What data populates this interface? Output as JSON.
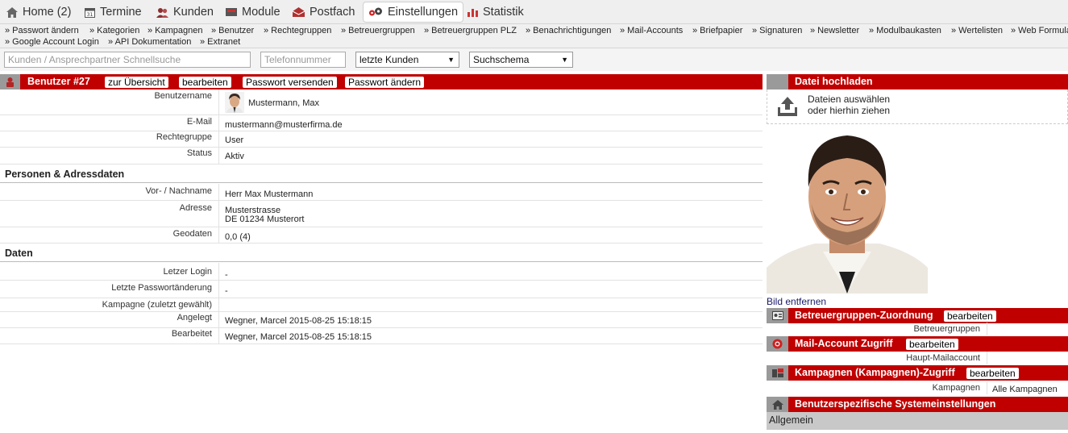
{
  "topnav": {
    "home": "Home (2)",
    "termine": "Termine",
    "kunden": "Kunden",
    "module": "Module",
    "postfach": "Postfach",
    "einstellungen": "Einstellungen",
    "statistik": "Statistik"
  },
  "subnav": {
    "items": [
      "» Passwort ändern",
      "» Kategorien",
      "» Kampagnen",
      "» Benutzer",
      "» Rechtegruppen",
      "» Betreuergruppen",
      "» Betreuergruppen PLZ",
      "» Benachrichtigungen",
      "» Mail-Accounts",
      "» Briefpapier",
      "» Signaturen",
      "» Newsletter",
      "» Modulbaukasten",
      "» Wertelisten",
      "» Web Formulare"
    ],
    "items2": [
      "» Google Account Login",
      "» API Dokumentation",
      "» Extranet"
    ]
  },
  "search": {
    "quick_placeholder": "Kunden / Ansprechpartner Schnellsuche",
    "phone_placeholder": "Telefonnummer",
    "recent_customers": "letzte Kunden",
    "search_schema": "Suchschema"
  },
  "user_header": {
    "title": "Benutzer #27",
    "overview_button": "zur Übersicht",
    "edit_button": "bearbeiten",
    "send_password_button": "Passwort versenden",
    "change_password_button": "Passwort ändern"
  },
  "account": {
    "username_label": "Benutzername",
    "username": "Mustermann, Max",
    "email_label": "E-Mail",
    "email": "mustermann@musterfirma.de",
    "rights_label": "Rechtegruppe",
    "rights": "User",
    "status_label": "Status",
    "status": "Aktiv"
  },
  "person": {
    "section_title": "Personen & Adressdaten",
    "name_label": "Vor- / Nachname",
    "name": "Herr Max Mustermann",
    "address_label": "Adresse",
    "street": "Musterstrasse",
    "city": "DE 01234 Musterort",
    "geo_label": "Geodaten",
    "geo": "0,0 (4)"
  },
  "data": {
    "section_title": "Daten",
    "last_login_label": "Letzer Login",
    "last_login": "-",
    "last_pw_change_label": "Letzte Passwortänderung",
    "last_pw_change": "-",
    "campaign_label": "Kampagne (zuletzt gewählt)",
    "created_label": "Angelegt",
    "created": "Wegner, Marcel 2015-08-25 15:18:15",
    "edited_label": "Bearbeitet",
    "edited": "Wegner, Marcel 2015-08-25 15:18:15"
  },
  "upload": {
    "title": "Datei hochladen",
    "line1": "Dateien auswählen",
    "line2": "oder hierhin ziehen"
  },
  "right": {
    "remove_image": "Bild entfernen",
    "caregroups_title": "Betreuergruppen-Zuordnung",
    "caregroups_edit": "bearbeiten",
    "caregroups_label": "Betreuergruppen",
    "mail_title": "Mail-Account Zugriff",
    "mail_edit": "bearbeiten",
    "mail_label": "Haupt-Mailaccount",
    "campaigns_title": "Kampagnen (Kampagnen)-Zugriff",
    "campaigns_edit": "bearbeiten",
    "campaigns_label": "Kampagnen",
    "campaigns_value": "Alle Kampagnen",
    "system_title": "Benutzerspezifische Systemeinstellungen",
    "general": "Allgemein"
  },
  "colors": {
    "header_red": "#c00000",
    "icon_grey": "#9a9a9a"
  }
}
